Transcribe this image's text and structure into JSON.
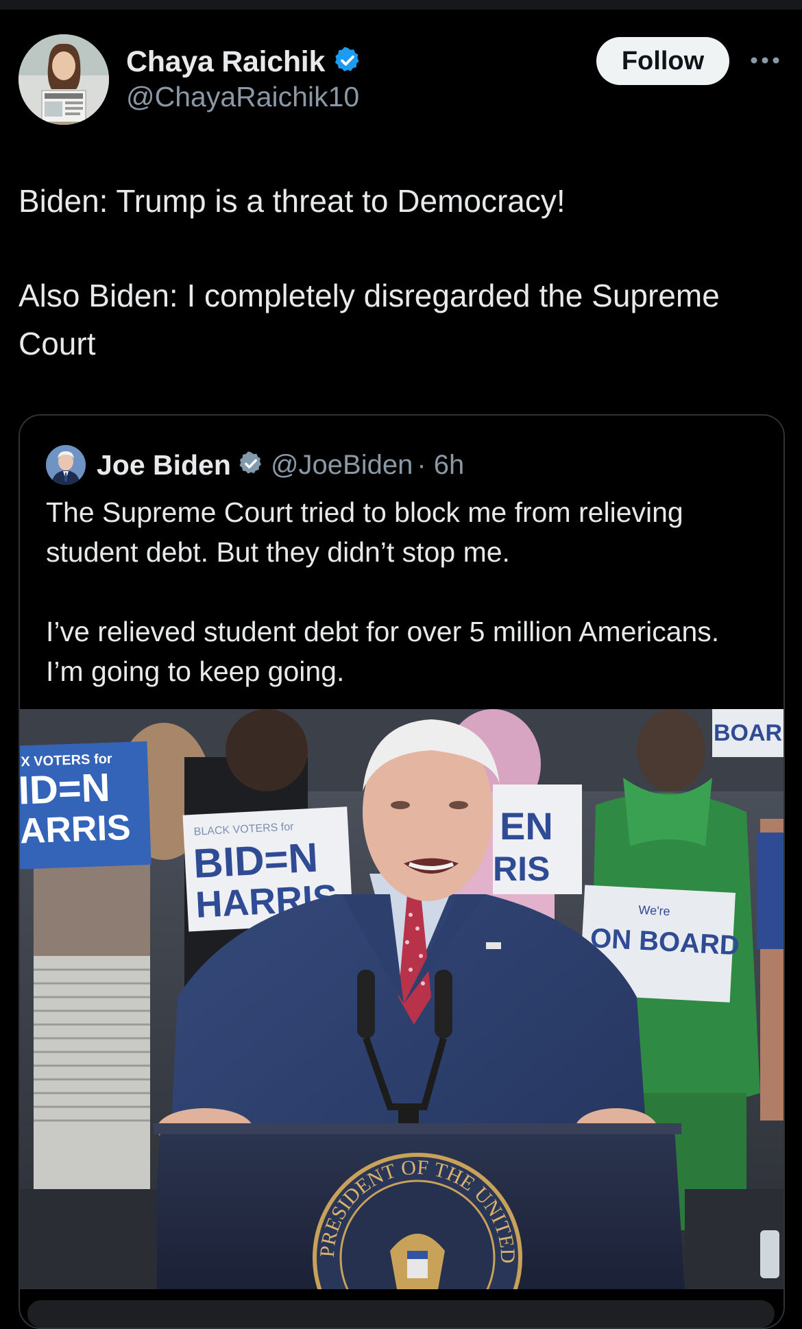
{
  "author": {
    "name": "Chaya Raichik",
    "handle": "@ChayaRaichik10",
    "verified": true
  },
  "follow_label": "Follow",
  "tweet": {
    "line1": "Biden: Trump is a threat to Democracy!",
    "line2": "Also Biden: I completely disregarded the Supreme Court"
  },
  "quote": {
    "name": "Joe Biden",
    "handle": "@JoeBiden",
    "time": "· 6h",
    "para1": "The Supreme Court tried to block me from relieving student debt. But they didn’t stop me.",
    "para2": "I’ve relieved student debt for over 5 million Americans. I’m going to keep going."
  },
  "media": {
    "sign_left_top": "X VOTERS for",
    "sign_left_big1": "ID=N",
    "sign_left_big2": "ARRIS",
    "sign_mid_top": "BLACK VOTERS for",
    "sign_mid_big1": "BID=N",
    "sign_mid_big2": "HARRIS",
    "sign_right_small": "We're",
    "sign_right_big": "ON BOARD",
    "sign_center_big1": "EN",
    "sign_center_big2": "RIS",
    "seal_text": "PRESIDENT OF THE UNITED",
    "board_top": "BOARD"
  },
  "colors": {
    "background": "#000000",
    "text": "#e7e9ea",
    "secondary_text": "#8b98a5",
    "verified_blue": "#1d9bf0",
    "follow_bg": "#eff3f4",
    "border": "#2f3336"
  }
}
